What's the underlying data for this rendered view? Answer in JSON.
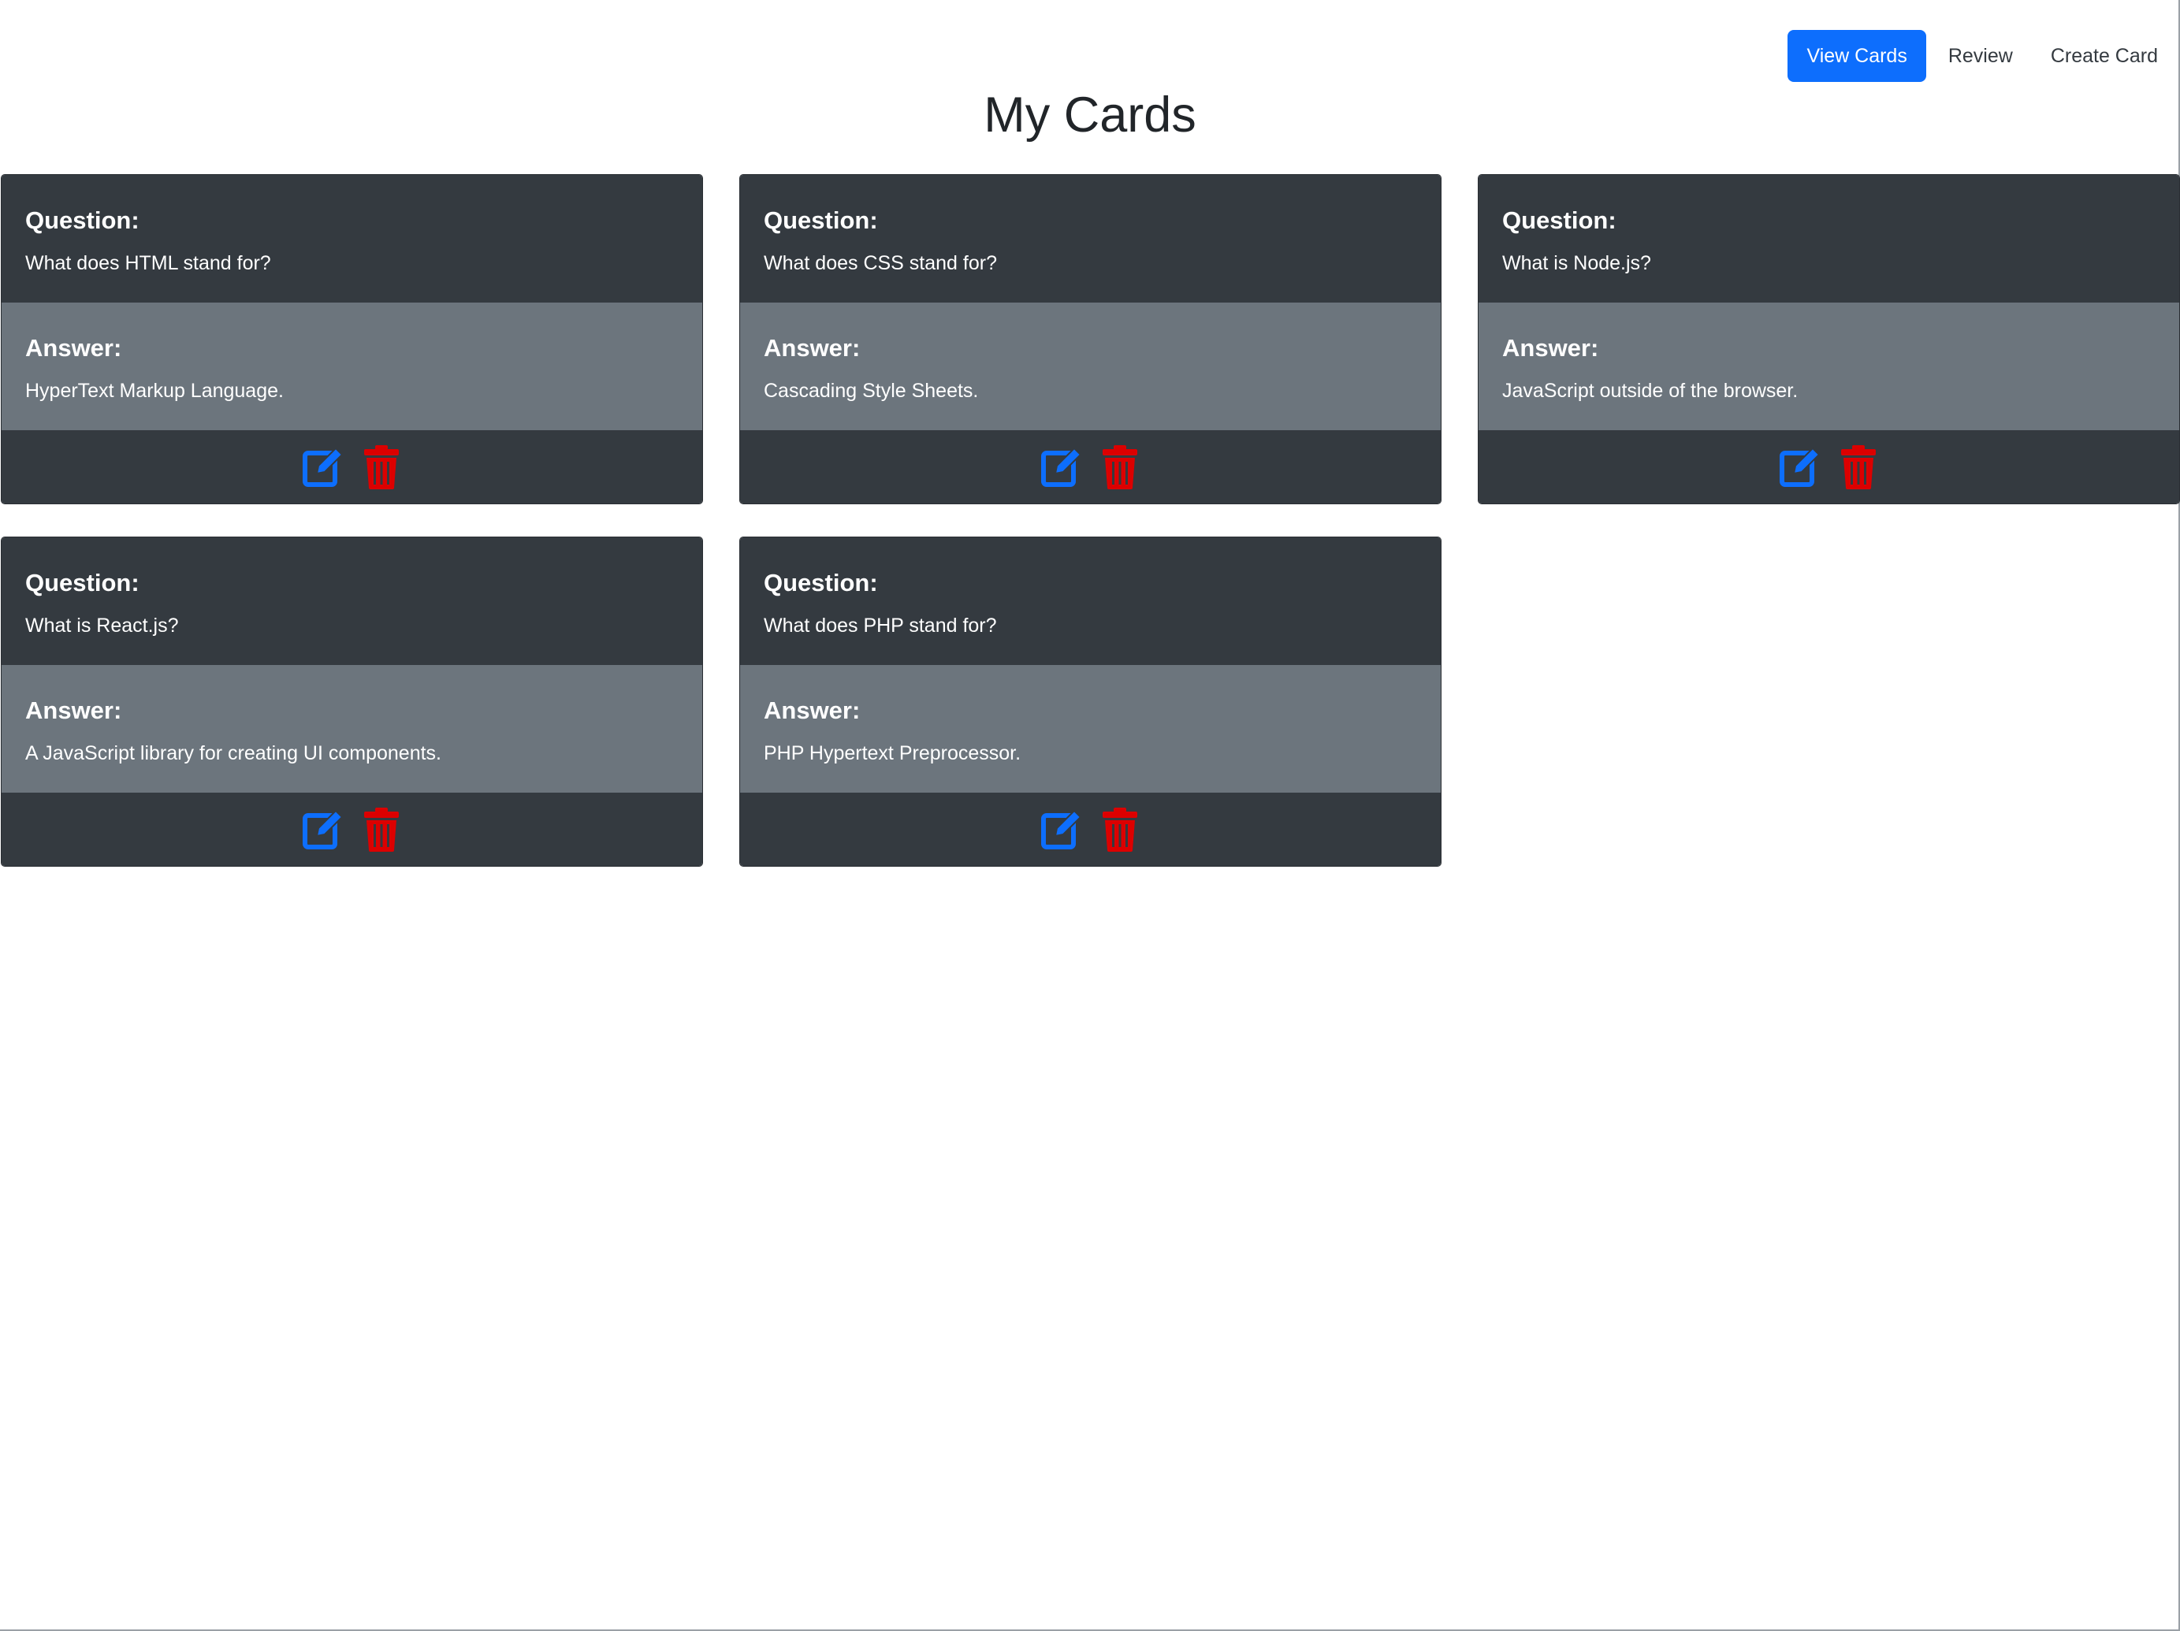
{
  "nav": {
    "items": [
      {
        "label": "View Cards",
        "active": true
      },
      {
        "label": "Review",
        "active": false
      },
      {
        "label": "Create Card",
        "active": false
      }
    ]
  },
  "page": {
    "title": "My Cards"
  },
  "colors": {
    "primary": "#0d6efd",
    "danger": "#dc0000",
    "card_dark": "#343a40",
    "card_gray": "#6c757d"
  },
  "cards": [
    {
      "question_label": "Question:",
      "question": "What does HTML stand for?",
      "answer_label": "Answer:",
      "answer": "HyperText Markup Language.",
      "edit_icon": "edit-icon",
      "delete_icon": "trash-icon"
    },
    {
      "question_label": "Question:",
      "question": "What does CSS stand for?",
      "answer_label": "Answer:",
      "answer": "Cascading Style Sheets.",
      "edit_icon": "edit-icon",
      "delete_icon": "trash-icon"
    },
    {
      "question_label": "Question:",
      "question": "What is Node.js?",
      "answer_label": "Answer:",
      "answer": "JavaScript outside of the browser.",
      "edit_icon": "edit-icon",
      "delete_icon": "trash-icon"
    },
    {
      "question_label": "Question:",
      "question": "What is React.js?",
      "answer_label": "Answer:",
      "answer": "A JavaScript library for creating UI components.",
      "edit_icon": "edit-icon",
      "delete_icon": "trash-icon"
    },
    {
      "question_label": "Question:",
      "question": "What does PHP stand for?",
      "answer_label": "Answer:",
      "answer": "PHP Hypertext Preprocessor.",
      "edit_icon": "edit-icon",
      "delete_icon": "trash-icon"
    }
  ]
}
